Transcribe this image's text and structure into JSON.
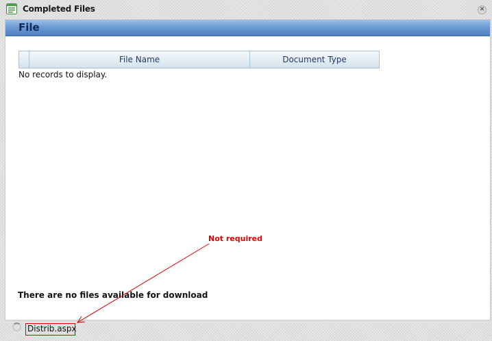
{
  "window": {
    "title": "Completed Files",
    "icon": "list-document-icon",
    "close_icon": "close-icon",
    "close_glyph": "✕"
  },
  "section": {
    "title": "File"
  },
  "grid": {
    "columns": [
      "File Name",
      "Document Type"
    ],
    "empty_message": "No records to display."
  },
  "message": {
    "no_files": "There are no files available for download"
  },
  "annotation": {
    "text": "Not required",
    "color": "#e00000"
  },
  "statusbar": {
    "text": "Distrib.aspx",
    "spinner_icon": "loading-spinner-icon"
  },
  "colors": {
    "header_bar": "#6d9bd4",
    "header_text": "#0c2b5a",
    "grid_header_text": "#20386a"
  }
}
